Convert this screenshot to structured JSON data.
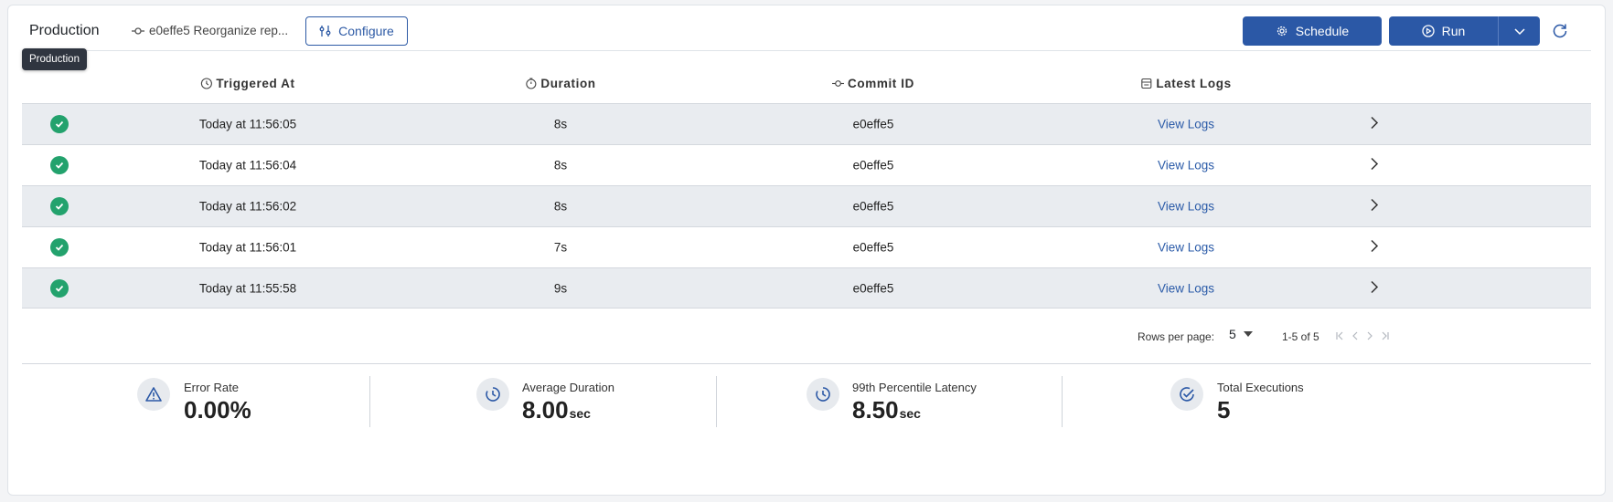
{
  "header": {
    "title": "Production",
    "commit_text": "e0effe5 Reorganize rep...",
    "configure_label": "Configure",
    "schedule_label": "Schedule",
    "run_label": "Run",
    "tooltip": "Production"
  },
  "table": {
    "columns": [
      "Triggered At",
      "Duration",
      "Commit ID",
      "Latest Logs"
    ],
    "rows": [
      {
        "status": "success",
        "triggered_at": "Today at 11:56:05",
        "duration": "8s",
        "commit": "e0effe5",
        "logs": "View Logs"
      },
      {
        "status": "success",
        "triggered_at": "Today at 11:56:04",
        "duration": "8s",
        "commit": "e0effe5",
        "logs": "View Logs"
      },
      {
        "status": "success",
        "triggered_at": "Today at 11:56:02",
        "duration": "8s",
        "commit": "e0effe5",
        "logs": "View Logs"
      },
      {
        "status": "success",
        "triggered_at": "Today at 11:56:01",
        "duration": "7s",
        "commit": "e0effe5",
        "logs": "View Logs"
      },
      {
        "status": "success",
        "triggered_at": "Today at 11:55:58",
        "duration": "9s",
        "commit": "e0effe5",
        "logs": "View Logs"
      }
    ]
  },
  "pagination": {
    "rows_per_page_label": "Rows per page:",
    "rows_per_page": "5",
    "range": "1-5 of 5"
  },
  "stats": [
    {
      "label": "Error Rate",
      "value": "0.00%",
      "unit": "",
      "icon": "warning-icon"
    },
    {
      "label": "Average Duration",
      "value": "8.00",
      "unit": "sec",
      "icon": "timer-icon"
    },
    {
      "label": "99th Percentile Latency",
      "value": "8.50",
      "unit": "sec",
      "icon": "timer-icon"
    },
    {
      "label": "Total Executions",
      "value": "5",
      "unit": "",
      "icon": "check-circle-icon"
    }
  ],
  "colors": {
    "primary": "#2b58a6",
    "success": "#23a26d",
    "link": "#2b5ba8"
  }
}
